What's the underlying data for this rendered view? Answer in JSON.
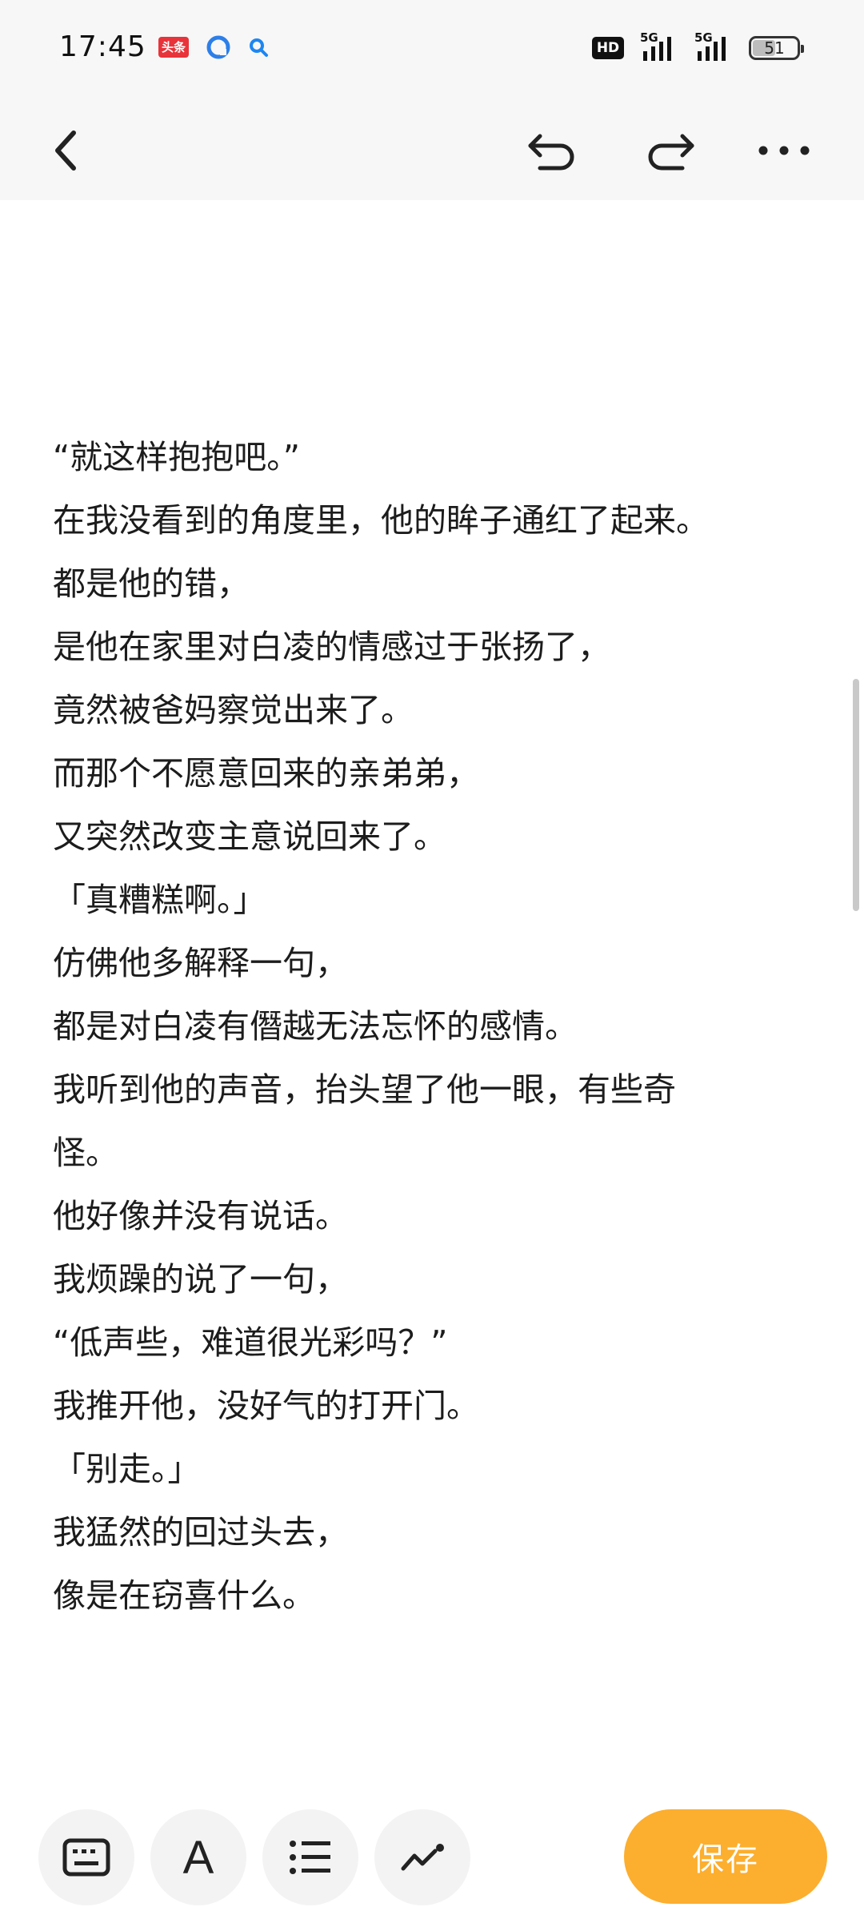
{
  "status_bar": {
    "time": "17:45",
    "notif_badge": "头条",
    "hd_label": "HD",
    "signal1_label": "5G",
    "signal2_label": "5G",
    "battery": "51"
  },
  "toolbar": {
    "back_icon": "chevron-left-icon",
    "undo_icon": "undo-icon",
    "redo_icon": "redo-icon",
    "more_icon": "more-horizontal-icon"
  },
  "content": {
    "lines": [
      "“就这样抱抱吧。”",
      "在我没看到的角度里，他的眸子通红了起来。",
      "都是他的错，",
      "是他在家里对白凌的情感过于张扬了，",
      "竟然被爸妈察觉出来了。",
      "而那个不愿意回来的亲弟弟，",
      "又突然改变主意说回来了。",
      "「真糟糕啊。」",
      "仿佛他多解释一句，",
      "都是对白凌有僭越无法忘怀的感情。",
      "我听到他的声音，抬头望了他一眼，有些奇",
      "怪。",
      "他好像并没有说话。",
      "我烦躁的说了一句，",
      "“低声些，难道很光彩吗？”",
      "我推开他，没好气的打开门。",
      "「别走。」",
      "我猛然的回过头去，",
      "像是在窃喜什么。"
    ]
  },
  "bottom_bar": {
    "keyboard_icon": "keyboard-icon",
    "font_label": "A",
    "list_icon": "list-icon",
    "draw_icon": "draw-icon",
    "save_label": "保存",
    "accent_color": "#fcae2e"
  }
}
